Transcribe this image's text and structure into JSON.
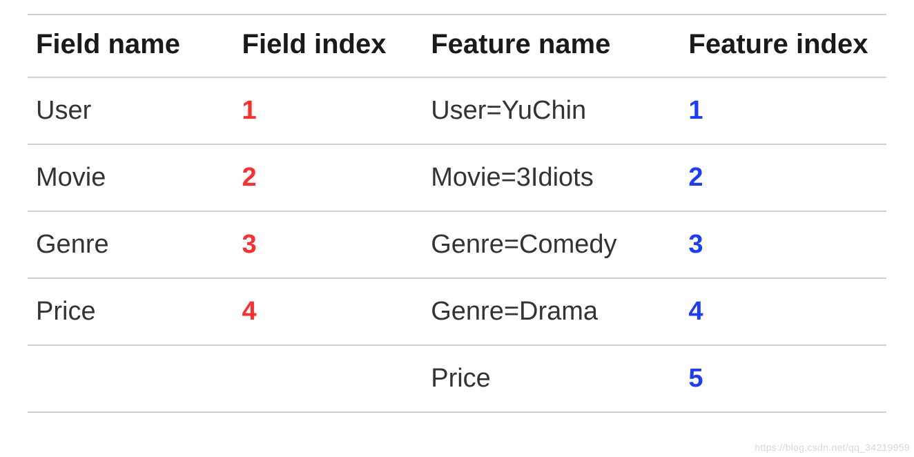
{
  "table": {
    "headers": {
      "col1": "Field name",
      "col2": "Field index",
      "col3": "Feature name",
      "col4": "Feature index"
    },
    "rows": [
      {
        "field_name": "User",
        "field_index": "1",
        "feature_name": "User=YuChin",
        "feature_index": "1"
      },
      {
        "field_name": "Movie",
        "field_index": "2",
        "feature_name": "Movie=3Idiots",
        "feature_index": "2"
      },
      {
        "field_name": "Genre",
        "field_index": "3",
        "feature_name": "Genre=Comedy",
        "feature_index": "3"
      },
      {
        "field_name": "Price",
        "field_index": "4",
        "feature_name": "Genre=Drama",
        "feature_index": "4"
      },
      {
        "field_name": "",
        "field_index": "",
        "feature_name": "Price",
        "feature_index": "5"
      }
    ]
  },
  "watermark": "https://blog.csdn.net/qq_34219959",
  "colors": {
    "red": "#ff2d2d",
    "blue": "#1a3cff"
  }
}
